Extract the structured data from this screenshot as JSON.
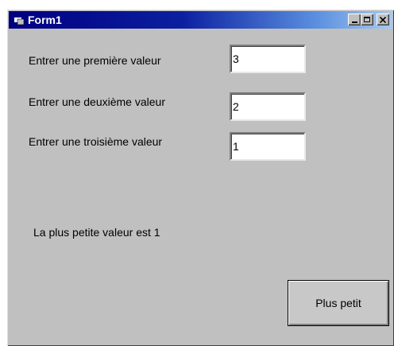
{
  "window": {
    "title": "Form1"
  },
  "fields": [
    {
      "label": "Entrer une première valeur",
      "value": "3"
    },
    {
      "label": "Entrer une deuxième valeur",
      "value": "2"
    },
    {
      "label": "Entrer une troisième valeur",
      "value": "1"
    }
  ],
  "result": {
    "text": "La plus petite valeur est 1"
  },
  "button": {
    "label": "Plus petit"
  }
}
